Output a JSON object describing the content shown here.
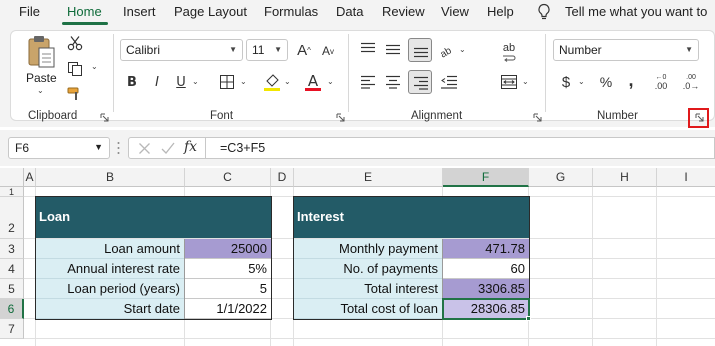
{
  "menu": {
    "items": [
      "File",
      "Home",
      "Insert",
      "Page Layout",
      "Formulas",
      "Data",
      "Review",
      "View",
      "Help"
    ],
    "active": "Home",
    "tell_me": "Tell me what you want to"
  },
  "ribbon": {
    "clipboard": {
      "label": "Clipboard",
      "paste_label": "Paste"
    },
    "font": {
      "label": "Font",
      "font_name": "Calibri",
      "font_size": "11",
      "bold": "B",
      "italic": "I",
      "underline": "U",
      "grow_font": "A",
      "shrink_font": "A",
      "font_color": "A",
      "font_color_swatch": "#e81123"
    },
    "alignment": {
      "label": "Alignment",
      "wrap_text": "ab"
    },
    "number": {
      "label": "Number",
      "format": "Number",
      "currency": "$",
      "percent": "%",
      "comma": ",",
      "increase_decimal": ".00",
      "decrease_decimal": ".0"
    },
    "highlight_color": "#e0191b"
  },
  "formula_bar": {
    "name_box": "F6",
    "fx": "fx",
    "formula": "=C3+F5"
  },
  "grid": {
    "columns": [
      "A",
      "B",
      "C",
      "D",
      "E",
      "F",
      "G",
      "H",
      "I"
    ],
    "selected_column": "F",
    "rows": [
      "1",
      "2",
      "3",
      "4",
      "5",
      "6",
      "7"
    ],
    "selected_row": "6"
  },
  "loan_table": {
    "header": "Loan",
    "rows": [
      {
        "label": "Loan amount",
        "value": "25000"
      },
      {
        "label": "Annual interest rate",
        "value": "5%"
      },
      {
        "label": "Loan period (years)",
        "value": "5"
      },
      {
        "label": "Start date",
        "value": "1/1/2022"
      }
    ]
  },
  "interest_table": {
    "header": "Interest",
    "rows": [
      {
        "label": "Monthly payment",
        "value": "471.78"
      },
      {
        "label": "No. of payments",
        "value": "60"
      },
      {
        "label": "Total interest",
        "value": "3306.85"
      },
      {
        "label": "Total cost of loan",
        "value": "28306.85"
      }
    ]
  },
  "colors": {
    "header_fill": "#235b67",
    "label_fill": "#daeef3",
    "input_fill": "#a69bd1",
    "accent": "#217346"
  }
}
